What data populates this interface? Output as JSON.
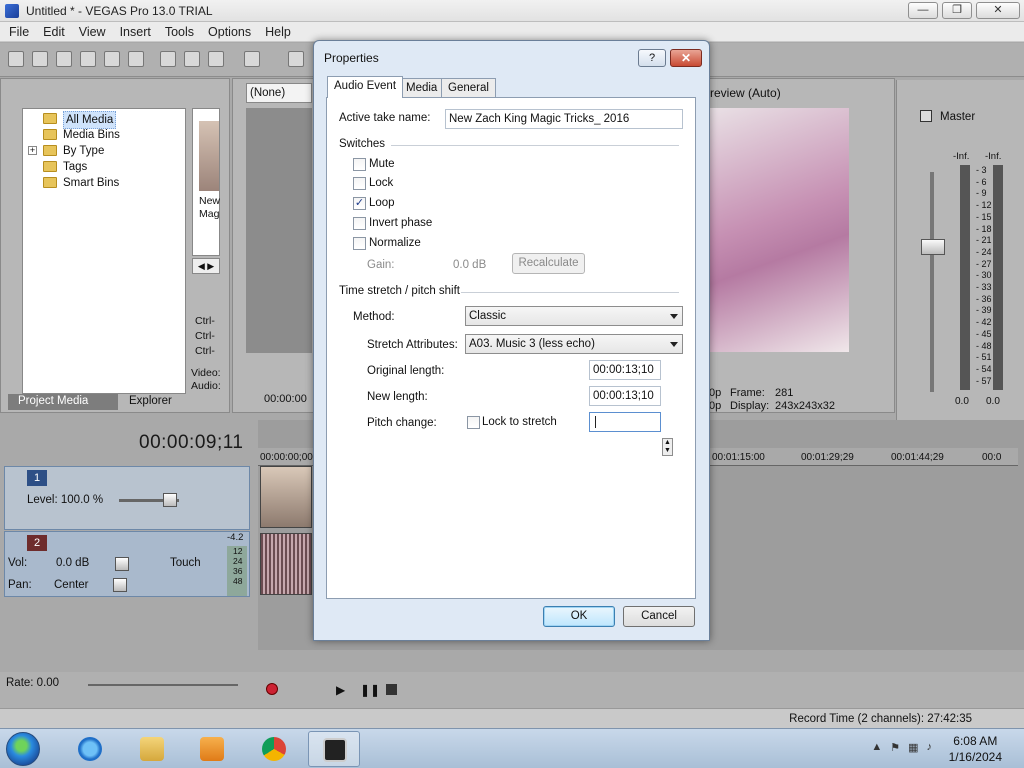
{
  "window": {
    "title": "Untitled * - VEGAS Pro 13.0 TRIAL"
  },
  "menu": [
    "File",
    "Edit",
    "View",
    "Insert",
    "Tools",
    "Options",
    "Help"
  ],
  "project_media": {
    "tree": [
      "All Media",
      "Media Bins",
      "By Type",
      "Tags",
      "Smart Bins"
    ],
    "tabs": [
      "Project Media",
      "Explorer"
    ],
    "thumb_caption": [
      "New",
      "Mag"
    ],
    "side_labels": [
      "Ctrl-",
      "Ctrl-",
      "Ctrl-"
    ],
    "video_audio": [
      "Video:",
      "Audio:"
    ]
  },
  "trimmer": {
    "dropdown": "(None)",
    "timecode": "00:00:00"
  },
  "preview": {
    "mode": "review (Auto)",
    "frame_label": "Frame:",
    "frame_value": "281",
    "display_label": "Display:",
    "display_value": "243x243x32",
    "left_labels": [
      "0p",
      "0p"
    ]
  },
  "master": {
    "title": "Master",
    "inf_left": "-Inf.",
    "inf_right": "-Inf.",
    "scale": [
      "3",
      "6",
      "9",
      "12",
      "15",
      "18",
      "21",
      "24",
      "27",
      "30",
      "33",
      "36",
      "39",
      "42",
      "45",
      "48",
      "51",
      "54",
      "57"
    ],
    "bottom_left": "0.0",
    "bottom_right": "0.0"
  },
  "timeline": {
    "time": "00:00:09;11",
    "ruler": [
      "00:00:00;00",
      "00:01:15:00",
      "00:01:29;29",
      "00:01:44;29",
      "00:0"
    ],
    "track1": {
      "num": "1",
      "level": "Level: 100.0 %"
    },
    "track2": {
      "num": "2",
      "vol": "Vol:",
      "vol_value": "0.0 dB",
      "pan": "Pan:",
      "pan_value": "Center",
      "touch": "Touch",
      "meter_top": "-4.2",
      "meter_scale": [
        "12",
        "24",
        "36",
        "48"
      ]
    }
  },
  "transport": {
    "rate": "Rate: 0.00"
  },
  "status": {
    "record_time": "Record Time (2 channels): 27:42:35"
  },
  "taskbar": {
    "time": "6:08 AM",
    "date": "1/16/2024"
  },
  "dialog": {
    "title": "Properties",
    "help": "?",
    "close": "✕",
    "tabs": [
      "Audio Event",
      "Media",
      "General"
    ],
    "active_take_label": "Active take name:",
    "active_take_value": "New Zach King Magic Tricks_ 2016",
    "switches_label": "Switches",
    "switches": [
      {
        "label": "Mute",
        "checked": ""
      },
      {
        "label": "Lock",
        "checked": ""
      },
      {
        "label": "Loop",
        "checked": "✓"
      },
      {
        "label": "Invert phase",
        "checked": ""
      },
      {
        "label": "Normalize",
        "checked": ""
      }
    ],
    "gain_label": "Gain:",
    "gain_value": "0.0 dB",
    "recalculate": "Recalculate",
    "stretch_section": "Time stretch / pitch shift",
    "method_label": "Method:",
    "method_value": "Classic",
    "attributes_label": "Stretch Attributes:",
    "attributes_value": "A03. Music 3 (less echo)",
    "original_length_label": "Original length:",
    "original_length_value": "00:00:13;10",
    "new_length_label": "New length:",
    "new_length_value": "00:00:13;10",
    "pitch_change_label": "Pitch change:",
    "lock_to_stretch": "Lock to stretch",
    "pitch_value": "",
    "ok": "OK",
    "cancel": "Cancel"
  }
}
